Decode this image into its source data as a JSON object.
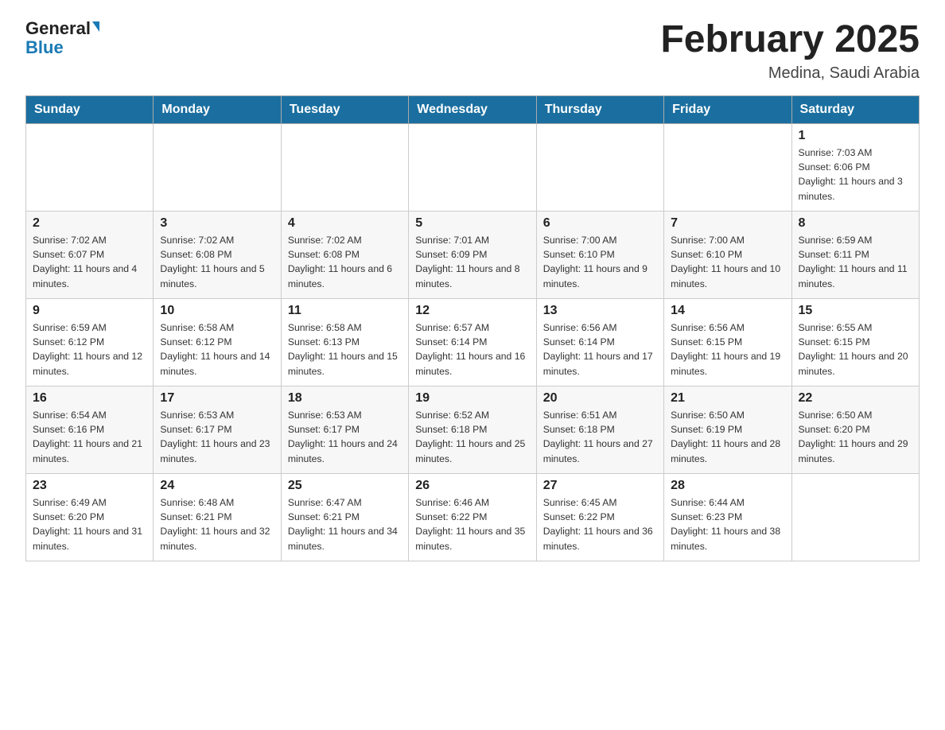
{
  "header": {
    "logo_line1": "General",
    "logo_line2": "Blue",
    "month_title": "February 2025",
    "location": "Medina, Saudi Arabia"
  },
  "weekdays": [
    "Sunday",
    "Monday",
    "Tuesday",
    "Wednesday",
    "Thursday",
    "Friday",
    "Saturday"
  ],
  "weeks": [
    [
      {
        "day": "",
        "sunrise": "",
        "sunset": "",
        "daylight": ""
      },
      {
        "day": "",
        "sunrise": "",
        "sunset": "",
        "daylight": ""
      },
      {
        "day": "",
        "sunrise": "",
        "sunset": "",
        "daylight": ""
      },
      {
        "day": "",
        "sunrise": "",
        "sunset": "",
        "daylight": ""
      },
      {
        "day": "",
        "sunrise": "",
        "sunset": "",
        "daylight": ""
      },
      {
        "day": "",
        "sunrise": "",
        "sunset": "",
        "daylight": ""
      },
      {
        "day": "1",
        "sunrise": "Sunrise: 7:03 AM",
        "sunset": "Sunset: 6:06 PM",
        "daylight": "Daylight: 11 hours and 3 minutes."
      }
    ],
    [
      {
        "day": "2",
        "sunrise": "Sunrise: 7:02 AM",
        "sunset": "Sunset: 6:07 PM",
        "daylight": "Daylight: 11 hours and 4 minutes."
      },
      {
        "day": "3",
        "sunrise": "Sunrise: 7:02 AM",
        "sunset": "Sunset: 6:08 PM",
        "daylight": "Daylight: 11 hours and 5 minutes."
      },
      {
        "day": "4",
        "sunrise": "Sunrise: 7:02 AM",
        "sunset": "Sunset: 6:08 PM",
        "daylight": "Daylight: 11 hours and 6 minutes."
      },
      {
        "day": "5",
        "sunrise": "Sunrise: 7:01 AM",
        "sunset": "Sunset: 6:09 PM",
        "daylight": "Daylight: 11 hours and 8 minutes."
      },
      {
        "day": "6",
        "sunrise": "Sunrise: 7:00 AM",
        "sunset": "Sunset: 6:10 PM",
        "daylight": "Daylight: 11 hours and 9 minutes."
      },
      {
        "day": "7",
        "sunrise": "Sunrise: 7:00 AM",
        "sunset": "Sunset: 6:10 PM",
        "daylight": "Daylight: 11 hours and 10 minutes."
      },
      {
        "day": "8",
        "sunrise": "Sunrise: 6:59 AM",
        "sunset": "Sunset: 6:11 PM",
        "daylight": "Daylight: 11 hours and 11 minutes."
      }
    ],
    [
      {
        "day": "9",
        "sunrise": "Sunrise: 6:59 AM",
        "sunset": "Sunset: 6:12 PM",
        "daylight": "Daylight: 11 hours and 12 minutes."
      },
      {
        "day": "10",
        "sunrise": "Sunrise: 6:58 AM",
        "sunset": "Sunset: 6:12 PM",
        "daylight": "Daylight: 11 hours and 14 minutes."
      },
      {
        "day": "11",
        "sunrise": "Sunrise: 6:58 AM",
        "sunset": "Sunset: 6:13 PM",
        "daylight": "Daylight: 11 hours and 15 minutes."
      },
      {
        "day": "12",
        "sunrise": "Sunrise: 6:57 AM",
        "sunset": "Sunset: 6:14 PM",
        "daylight": "Daylight: 11 hours and 16 minutes."
      },
      {
        "day": "13",
        "sunrise": "Sunrise: 6:56 AM",
        "sunset": "Sunset: 6:14 PM",
        "daylight": "Daylight: 11 hours and 17 minutes."
      },
      {
        "day": "14",
        "sunrise": "Sunrise: 6:56 AM",
        "sunset": "Sunset: 6:15 PM",
        "daylight": "Daylight: 11 hours and 19 minutes."
      },
      {
        "day": "15",
        "sunrise": "Sunrise: 6:55 AM",
        "sunset": "Sunset: 6:15 PM",
        "daylight": "Daylight: 11 hours and 20 minutes."
      }
    ],
    [
      {
        "day": "16",
        "sunrise": "Sunrise: 6:54 AM",
        "sunset": "Sunset: 6:16 PM",
        "daylight": "Daylight: 11 hours and 21 minutes."
      },
      {
        "day": "17",
        "sunrise": "Sunrise: 6:53 AM",
        "sunset": "Sunset: 6:17 PM",
        "daylight": "Daylight: 11 hours and 23 minutes."
      },
      {
        "day": "18",
        "sunrise": "Sunrise: 6:53 AM",
        "sunset": "Sunset: 6:17 PM",
        "daylight": "Daylight: 11 hours and 24 minutes."
      },
      {
        "day": "19",
        "sunrise": "Sunrise: 6:52 AM",
        "sunset": "Sunset: 6:18 PM",
        "daylight": "Daylight: 11 hours and 25 minutes."
      },
      {
        "day": "20",
        "sunrise": "Sunrise: 6:51 AM",
        "sunset": "Sunset: 6:18 PM",
        "daylight": "Daylight: 11 hours and 27 minutes."
      },
      {
        "day": "21",
        "sunrise": "Sunrise: 6:50 AM",
        "sunset": "Sunset: 6:19 PM",
        "daylight": "Daylight: 11 hours and 28 minutes."
      },
      {
        "day": "22",
        "sunrise": "Sunrise: 6:50 AM",
        "sunset": "Sunset: 6:20 PM",
        "daylight": "Daylight: 11 hours and 29 minutes."
      }
    ],
    [
      {
        "day": "23",
        "sunrise": "Sunrise: 6:49 AM",
        "sunset": "Sunset: 6:20 PM",
        "daylight": "Daylight: 11 hours and 31 minutes."
      },
      {
        "day": "24",
        "sunrise": "Sunrise: 6:48 AM",
        "sunset": "Sunset: 6:21 PM",
        "daylight": "Daylight: 11 hours and 32 minutes."
      },
      {
        "day": "25",
        "sunrise": "Sunrise: 6:47 AM",
        "sunset": "Sunset: 6:21 PM",
        "daylight": "Daylight: 11 hours and 34 minutes."
      },
      {
        "day": "26",
        "sunrise": "Sunrise: 6:46 AM",
        "sunset": "Sunset: 6:22 PM",
        "daylight": "Daylight: 11 hours and 35 minutes."
      },
      {
        "day": "27",
        "sunrise": "Sunrise: 6:45 AM",
        "sunset": "Sunset: 6:22 PM",
        "daylight": "Daylight: 11 hours and 36 minutes."
      },
      {
        "day": "28",
        "sunrise": "Sunrise: 6:44 AM",
        "sunset": "Sunset: 6:23 PM",
        "daylight": "Daylight: 11 hours and 38 minutes."
      },
      {
        "day": "",
        "sunrise": "",
        "sunset": "",
        "daylight": ""
      }
    ]
  ]
}
